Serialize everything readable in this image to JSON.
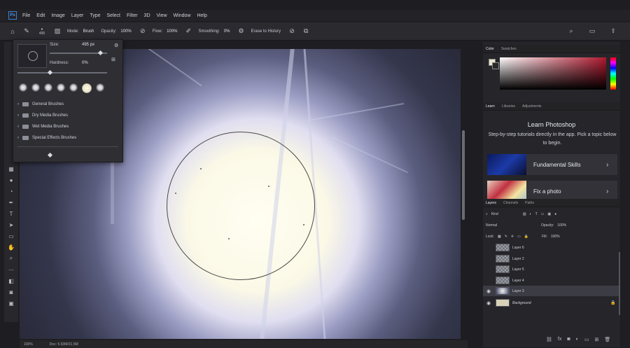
{
  "menu": {
    "logo": "Ps",
    "items": [
      "File",
      "Edit",
      "Image",
      "Layer",
      "Type",
      "Select",
      "Filter",
      "3D",
      "View",
      "Window",
      "Help"
    ]
  },
  "options": {
    "brush_size_label": "495",
    "mode_label": "Mode:",
    "mode_value": "Brush",
    "opacity_label": "Opacity:",
    "opacity_value": "100%",
    "flow_label": "Flow:",
    "flow_value": "100%",
    "smoothing_label": "Smoothing:",
    "smoothing_value": "0%",
    "erase_to_history": "Erase to History"
  },
  "brush_popup": {
    "size_label": "Size:",
    "size_value": "495 px",
    "hardness_label": "Hardness:",
    "hardness_value": "0%",
    "size_fraction": 0.87,
    "hardness_fraction": 0.0,
    "folders": [
      "General Brushes",
      "Dry Media Brushes",
      "Wet Media Brushes",
      "Special Effects Brushes"
    ]
  },
  "status": {
    "zoom": "100%",
    "doc": "Doc: 5.93M/21.5M"
  },
  "panels": {
    "color_tabs": [
      "Color",
      "Swatches"
    ],
    "learn_tabs": [
      "Learn",
      "Libraries",
      "Adjustments"
    ],
    "learn_title": "Learn Photoshop",
    "learn_desc": "Step-by-step tutorials directly in the app. Pick a topic below to begin.",
    "cards": [
      {
        "label": "Fundamental Skills"
      },
      {
        "label": "Fix a photo"
      }
    ],
    "layer_tabs": [
      "Layers",
      "Channels",
      "Paths"
    ],
    "kind_label": "Kind",
    "blend_mode": "Normal",
    "opacity_label": "Opacity:",
    "opacity_value": "100%",
    "lock_label": "Lock:",
    "fill_label": "Fill:",
    "fill_value": "100%",
    "layers": [
      {
        "name": "Layer 6"
      },
      {
        "name": "Layer 2"
      },
      {
        "name": "Layer 5"
      },
      {
        "name": "Layer 4"
      },
      {
        "name": "Layer 3"
      },
      {
        "name": "Background"
      }
    ]
  },
  "colors": {
    "accent": "#3a82d6",
    "panel_bg": "#26262a",
    "canvas_glow": "#fffef2"
  }
}
